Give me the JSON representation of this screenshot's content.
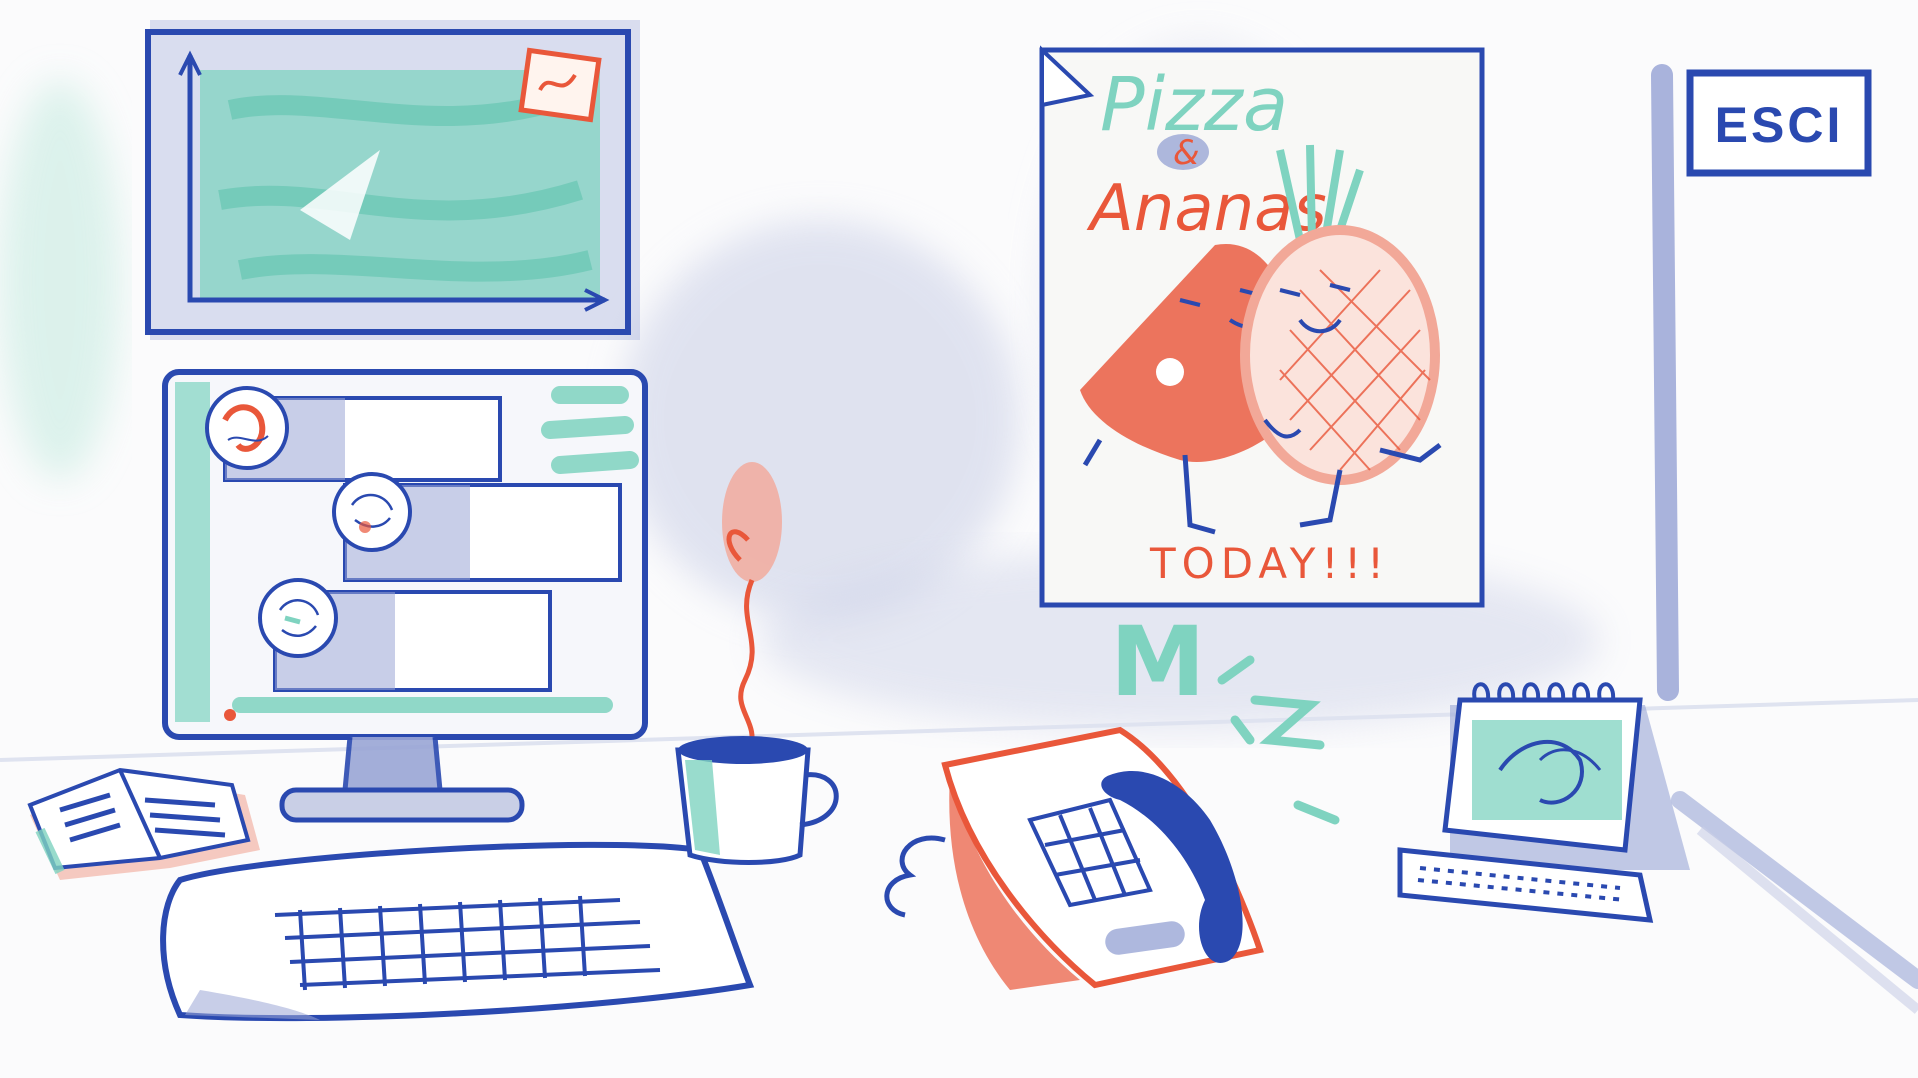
{
  "exit_sign": {
    "label": "ESCI"
  },
  "poster": {
    "title_line1": "Pizza",
    "title_amp": "&",
    "title_line2": "Ananas",
    "footer": "TODAY!!!"
  },
  "phone_sound": {
    "text": "M"
  },
  "colors": {
    "ink_blue": "#2a49b0",
    "mint": "#7fd3c0",
    "coral": "#e9573a",
    "soft_blue": "#9aa6d6",
    "pale_red": "#f2a898"
  }
}
